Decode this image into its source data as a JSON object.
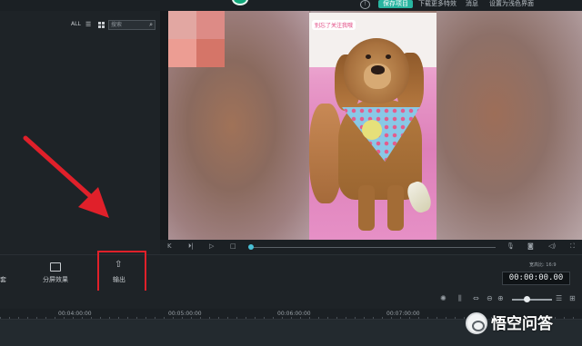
{
  "topbar": {
    "save_label": "保存项目",
    "links": [
      "下载更多特效",
      "消息",
      "设置为浅色界面"
    ]
  },
  "media_panel": {
    "filter_all": "ALL",
    "search_placeholder": "搜索"
  },
  "preview": {
    "caption": "别忘了关注我哦"
  },
  "toolbar": {
    "partial_left": "套",
    "split_effect_label": "分屏效果",
    "export_label": "输出",
    "aspect_ratio_label": "宽高比: 16:9",
    "timecode": "00:00:00.00"
  },
  "timeline": {
    "ruler_labels": [
      "00:04:00:00",
      "00:05:00:00",
      "00:06:00:00",
      "00:07:00:00"
    ]
  },
  "watermark": {
    "text": "悟空问答"
  },
  "colors": {
    "accent": "#28b5a0",
    "annotation_red": "#e0202a",
    "playhead": "#49c0d6"
  }
}
